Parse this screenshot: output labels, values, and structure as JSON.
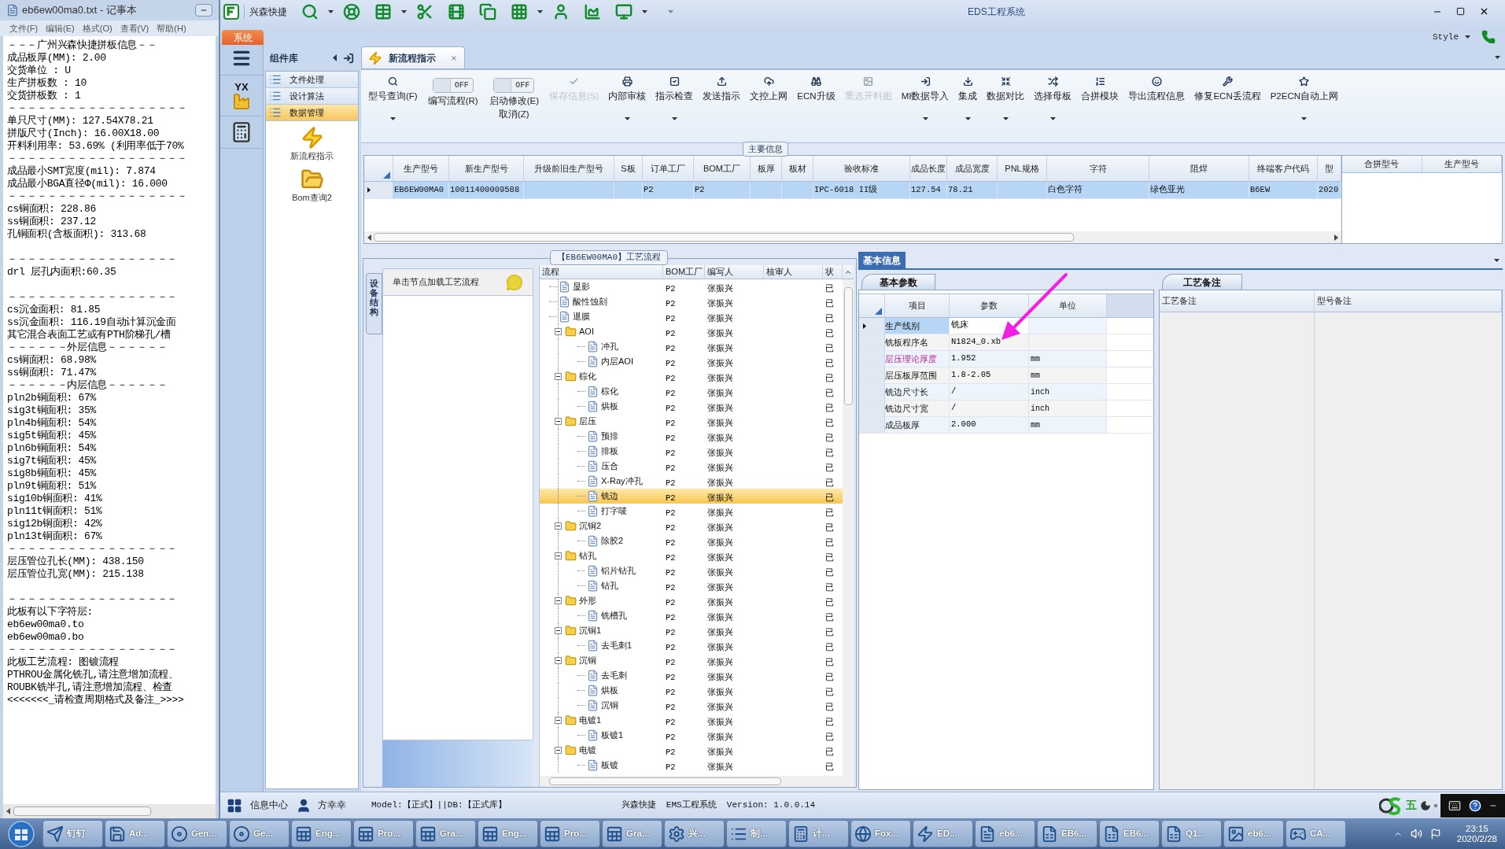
{
  "notepad": {
    "title": "eb6ew00ma0.txt - 记事本",
    "menu": [
      "文件(F)",
      "编辑(E)",
      "格式(O)",
      "查看(V)",
      "帮助(H)"
    ],
    "lines": [
      {
        "kind": "text",
        "text": "－－－广州兴森快捷拼板信息－－"
      },
      {
        "kind": "text",
        "text": "成品板厚(MM): 2.00"
      },
      {
        "kind": "text",
        "text": "交货单位 : U"
      },
      {
        "kind": "text",
        "text": "生产拼板数 : 10"
      },
      {
        "kind": "text",
        "text": "交货拼板数 : 1"
      },
      {
        "kind": "text",
        "text": "－－－－－－－－－－－－－－－－－－"
      },
      {
        "kind": "text",
        "text": "单只尺寸(MM): 127.54X78.21"
      },
      {
        "kind": "text",
        "text": "拼版尺寸(Inch): 16.00X18.00"
      },
      {
        "kind": "text",
        "text": "开料利用率: 53.69% (利用率低于70%"
      },
      {
        "kind": "text",
        "text": "－－－－－－－－－－－－－－－－－－"
      },
      {
        "kind": "text",
        "text": "成品最小SMT宽度(mil): 7.874"
      },
      {
        "kind": "text",
        "text": "成品最小BGA直径Φ(mil):  16.000"
      },
      {
        "kind": "text",
        "text": "－－－－－－－－－－－－－－－－－－"
      },
      {
        "kind": "text",
        "text": "cs铜面积: 228.86"
      },
      {
        "kind": "text",
        "text": "ss铜面积: 237.12"
      },
      {
        "kind": "text",
        "text": "孔铜面积(含板面积): 313.68"
      },
      {
        "kind": "gap"
      },
      {
        "kind": "text",
        "text": "－－－－－－－－－－－－－－－－－"
      },
      {
        "kind": "text",
        "text": "drl          层孔内面积:60.35"
      },
      {
        "kind": "gap"
      },
      {
        "kind": "text",
        "text": "－－－－－－－－－－－－－－－－－"
      },
      {
        "kind": "text",
        "text": "cs沉金面积: 81.85"
      },
      {
        "kind": "text",
        "text": "ss沉金面积: 116.19自动计算沉金面"
      },
      {
        "kind": "text",
        "text": "其它混合表面工艺或有PTH阶梯孔/槽"
      },
      {
        "kind": "text",
        "text": "－－－－－－外层信息－－－－－－"
      },
      {
        "kind": "text",
        "text": "cs铜面积: 68.98%"
      },
      {
        "kind": "text",
        "text": "ss铜面积: 71.47%"
      },
      {
        "kind": "text",
        "text": "－－－－－－内层信息－－－－－－"
      },
      {
        "kind": "text",
        "text": "pln2b铜面积: 67%"
      },
      {
        "kind": "text",
        "text": "sig3t铜面积: 35%"
      },
      {
        "kind": "text",
        "text": "pln4b铜面积: 54%"
      },
      {
        "kind": "text",
        "text": "sig5t铜面积: 45%"
      },
      {
        "kind": "text",
        "text": "pln6b铜面积: 54%"
      },
      {
        "kind": "text",
        "text": "sig7t铜面积: 45%"
      },
      {
        "kind": "text",
        "text": "sig8b铜面积: 45%"
      },
      {
        "kind": "text",
        "text": "pln9t铜面积: 51%"
      },
      {
        "kind": "text",
        "text": "sig10b铜面积: 41%"
      },
      {
        "kind": "text",
        "text": "pln11t铜面积: 51%"
      },
      {
        "kind": "text",
        "text": "sig12b铜面积: 42%"
      },
      {
        "kind": "text",
        "text": "pln13t铜面积: 67%"
      },
      {
        "kind": "text",
        "text": "－－－－－－－－－－－－－－－－－"
      },
      {
        "kind": "text",
        "text": "层压管位孔长(MM): 438.150"
      },
      {
        "kind": "text",
        "text": "层压管位孔宽(MM): 215.138"
      },
      {
        "kind": "gap"
      },
      {
        "kind": "text",
        "text": "－－－－－－－－－－－－－－－－－"
      },
      {
        "kind": "text",
        "text": "此板有以下字符层:"
      },
      {
        "kind": "text",
        "text": "eb6ew00ma0.to"
      },
      {
        "kind": "text",
        "text": "eb6ew00ma0.bo"
      },
      {
        "kind": "text",
        "text": "－－－－－－－－－－－－－－－－－"
      },
      {
        "kind": "text",
        "text": "此板工艺流程: 图镀流程"
      },
      {
        "kind": "text",
        "text": "PTHROU金属化铣孔,请注意增加流程、"
      },
      {
        "kind": "text",
        "text": "ROUBK铣半孔,请注意增加流程、检查"
      },
      {
        "kind": "text",
        "text": "<<<<<<<_请检查周期格式及备注_>>>>"
      }
    ]
  },
  "app": {
    "brand": "兴森快捷",
    "title": "EDS工程系统",
    "style_menu": "Style",
    "system_tab": "系统",
    "side_logo": "YX"
  },
  "components": {
    "title": "组件库",
    "items": [
      {
        "label": "文件处理",
        "selected": false
      },
      {
        "label": "设计算法",
        "selected": false
      },
      {
        "label": "数据管理",
        "selected": true
      }
    ],
    "shortcuts": [
      {
        "label": "新流程指示"
      },
      {
        "label": "Bom查询2"
      }
    ]
  },
  "doc_tab": {
    "label": "新流程指示"
  },
  "ribbon": [
    {
      "kind": "button",
      "label": "型号查询(F)",
      "disabled": false,
      "dropdown": true
    },
    {
      "kind": "toggle",
      "label": "编写流程(R)",
      "state": "OFF",
      "on": false
    },
    {
      "kind": "toggle",
      "label": "启动修改(E)",
      "sublabel": "取消(Z)",
      "state": "OFF",
      "on": false
    },
    {
      "kind": "button",
      "label": "保存信息(S)",
      "disabled": true,
      "dropdown": false
    },
    {
      "kind": "button",
      "label": "内部审核",
      "disabled": false,
      "dropdown": true
    },
    {
      "kind": "button",
      "label": "指示检查",
      "disabled": false,
      "dropdown": true
    },
    {
      "kind": "button",
      "label": "发送指示",
      "disabled": false,
      "dropdown": false
    },
    {
      "kind": "button",
      "label": "文控上网",
      "disabled": false,
      "dropdown": false
    },
    {
      "kind": "button",
      "label": "ECN升级",
      "disabled": false,
      "dropdown": false
    },
    {
      "kind": "button",
      "label": "重选开料图",
      "disabled": true,
      "dropdown": false
    },
    {
      "kind": "button",
      "label": "MI数据导入",
      "disabled": false,
      "dropdown": true
    },
    {
      "kind": "button",
      "label": "集成",
      "disabled": false,
      "dropdown": true
    },
    {
      "kind": "button",
      "label": "数据对比",
      "disabled": false,
      "dropdown": true
    },
    {
      "kind": "button",
      "label": "选择母板",
      "disabled": false,
      "dropdown": true
    },
    {
      "kind": "button",
      "label": "合拼模块",
      "disabled": false,
      "dropdown": false
    },
    {
      "kind": "button",
      "label": "导出流程信息",
      "disabled": false,
      "dropdown": false
    },
    {
      "kind": "button",
      "label": "修复ECN丢流程",
      "disabled": false,
      "dropdown": false
    },
    {
      "kind": "button",
      "label": "P2ECN自动上网",
      "disabled": false,
      "dropdown": true
    }
  ],
  "main_info": {
    "title": "主要信息",
    "columns": [
      "生产型号",
      "新生产型号",
      "升级前旧生产型号",
      "S板",
      "订单工厂",
      "BOM工厂",
      "板厚",
      "板材",
      "验收标准",
      "成品长度",
      "成品宽度",
      "PNL规格",
      "字符",
      "阻焊",
      "终端客户代码",
      "型"
    ],
    "rows": [
      {
        "selected": true,
        "cells": [
          "EB6EW00MA0",
          "10011400009588",
          null,
          null,
          "P2",
          "P2",
          null,
          null,
          "IPC-6018 II级",
          "127.54",
          "78.21",
          null,
          "白色字符",
          "绿色亚光",
          "B6EW",
          "2020"
        ]
      }
    ],
    "side_columns": [
      "合拼型号",
      "生产型号"
    ]
  },
  "flow": {
    "title": "【EB6EW00MA0】工艺流程",
    "side_tab": "设备结构",
    "hint": "单击节点加载工艺流程",
    "columns": [
      "流程",
      "BOM工厂",
      "编写人",
      "核审人",
      "状"
    ],
    "tree": [
      {
        "kind": "group",
        "children": [
          {
            "kind": "step",
            "name": "显影",
            "factory": "P2",
            "writer": "张振兴",
            "status": "已",
            "selected": false
          },
          {
            "kind": "step",
            "name": "酸性蚀刻",
            "factory": "P2",
            "writer": "张振兴",
            "status": "已",
            "selected": false
          },
          {
            "kind": "step",
            "name": "退膜",
            "factory": "P2",
            "writer": "张振兴",
            "status": "已",
            "selected": false
          }
        ]
      },
      {
        "kind": "group",
        "name": "AOI",
        "factory": "P2",
        "writer": "张振兴",
        "status": "已",
        "selected": false,
        "expanded": true,
        "children": [
          {
            "kind": "step",
            "name": "冲孔",
            "factory": "P2",
            "writer": "张振兴",
            "status": "已",
            "selected": false
          },
          {
            "kind": "step",
            "name": "内层AOI",
            "factory": "P2",
            "writer": "张振兴",
            "status": "已",
            "selected": false
          }
        ]
      },
      {
        "kind": "group",
        "name": "棕化",
        "factory": "P2",
        "writer": "张振兴",
        "status": "已",
        "selected": false,
        "expanded": true,
        "children": [
          {
            "kind": "step",
            "name": "棕化",
            "factory": "P2",
            "writer": "张振兴",
            "status": "已",
            "selected": false
          },
          {
            "kind": "step",
            "name": "烘板",
            "factory": "P2",
            "writer": "张振兴",
            "status": "已",
            "selected": false
          }
        ]
      },
      {
        "kind": "group",
        "name": "层压",
        "factory": "P2",
        "writer": "张振兴",
        "status": "已",
        "selected": false,
        "expanded": true,
        "children": [
          {
            "kind": "step",
            "name": "预排",
            "factory": "P2",
            "writer": "张振兴",
            "status": "已",
            "selected": false
          },
          {
            "kind": "step",
            "name": "排板",
            "factory": "P2",
            "writer": "张振兴",
            "status": "已",
            "selected": false
          },
          {
            "kind": "step",
            "name": "压合",
            "factory": "P2",
            "writer": "张振兴",
            "status": "已",
            "selected": false
          },
          {
            "kind": "step",
            "name": "X-Ray冲孔",
            "factory": "P2",
            "writer": "张振兴",
            "status": "已",
            "selected": false
          },
          {
            "kind": "step",
            "name": "铣边",
            "factory": "P2",
            "writer": "张振兴",
            "status": "已",
            "selected": true
          },
          {
            "kind": "step",
            "name": "打字唛",
            "factory": "P2",
            "writer": "张振兴",
            "status": "已",
            "selected": false
          }
        ]
      },
      {
        "kind": "group",
        "name": "沉铜2",
        "factory": "P2",
        "writer": "张振兴",
        "status": "已",
        "selected": false,
        "expanded": true,
        "children": [
          {
            "kind": "step",
            "name": "除胶2",
            "factory": "P2",
            "writer": "张振兴",
            "status": "已",
            "selected": false
          }
        ]
      },
      {
        "kind": "group",
        "name": "钻孔",
        "factory": "P2",
        "writer": "张振兴",
        "status": "已",
        "selected": false,
        "expanded": true,
        "children": [
          {
            "kind": "step",
            "name": "铝片钻孔",
            "factory": "P2",
            "writer": "张振兴",
            "status": "已",
            "selected": false
          },
          {
            "kind": "step",
            "name": "钻孔",
            "factory": "P2",
            "writer": "张振兴",
            "status": "已",
            "selected": false
          }
        ]
      },
      {
        "kind": "group",
        "name": "外形",
        "factory": "P2",
        "writer": "张振兴",
        "status": "已",
        "selected": false,
        "expanded": true,
        "children": [
          {
            "kind": "step",
            "name": "铣槽孔",
            "factory": "P2",
            "writer": "张振兴",
            "status": "已",
            "selected": false
          }
        ]
      },
      {
        "kind": "group",
        "name": "沉铜1",
        "factory": "P2",
        "writer": "张振兴",
        "status": "已",
        "selected": false,
        "expanded": true,
        "children": [
          {
            "kind": "step",
            "name": "去毛刺1",
            "factory": "P2",
            "writer": "张振兴",
            "status": "已",
            "selected": false
          }
        ]
      },
      {
        "kind": "group",
        "name": "沉铜",
        "factory": "P2",
        "writer": "张振兴",
        "status": "已",
        "selected": false,
        "expanded": true,
        "children": [
          {
            "kind": "step",
            "name": "去毛刺",
            "factory": "P2",
            "writer": "张振兴",
            "status": "已",
            "selected": false
          },
          {
            "kind": "step",
            "name": "烘板",
            "factory": "P2",
            "writer": "张振兴",
            "status": "已",
            "selected": false
          },
          {
            "kind": "step",
            "name": "沉铜",
            "factory": "P2",
            "writer": "张振兴",
            "status": "已",
            "selected": false
          }
        ]
      },
      {
        "kind": "group",
        "name": "电镀1",
        "factory": "P2",
        "writer": "张振兴",
        "status": "已",
        "selected": false,
        "expanded": true,
        "children": [
          {
            "kind": "step",
            "name": "板镀1",
            "factory": "P2",
            "writer": "张振兴",
            "status": "已",
            "selected": false
          }
        ]
      },
      {
        "kind": "group",
        "name": "电镀",
        "factory": "P2",
        "writer": "张振兴",
        "status": "已",
        "selected": false,
        "expanded": true,
        "children": [
          {
            "kind": "step",
            "name": "板镀",
            "factory": "P2",
            "writer": "张振兴",
            "status": "已",
            "selected": false
          }
        ]
      }
    ]
  },
  "basic_info": {
    "title": "基本信息",
    "params_tab": "基本参数",
    "columns": [
      "项目",
      "参数",
      "单位"
    ],
    "rows": [
      {
        "item": "生产线别",
        "value": "铣床",
        "unit": null,
        "selected": true,
        "highlighted": false
      },
      {
        "item": "铣板程序名",
        "value": "N1824_0.xb",
        "unit": null,
        "selected": false,
        "highlighted": false
      },
      {
        "item": "层压理论厚度",
        "value": "1.952",
        "unit": "mm",
        "selected": false,
        "highlighted": true
      },
      {
        "item": "层压板厚范围",
        "value": "1.8-2.05",
        "unit": "mm",
        "selected": false,
        "highlighted": false
      },
      {
        "item": "铣边尺寸长",
        "value": "/",
        "unit": "inch",
        "selected": false,
        "highlighted": false
      },
      {
        "item": "铣边尺寸宽",
        "value": "/",
        "unit": "inch",
        "selected": false,
        "highlighted": false
      },
      {
        "item": "成品板厚",
        "value": "2.000",
        "unit": "mm",
        "selected": false,
        "highlighted": false
      }
    ],
    "notes_tab": "工艺备注",
    "notes_columns": [
      "工艺备注",
      "型号备注"
    ]
  },
  "status_bar": {
    "info_center": "信息中心",
    "user": "方幸幸",
    "model": "Model:【正式】||DB:【正式库】",
    "version": "兴森快捷  EMS工程系统  Version: 1.0.0.14",
    "ime": "五"
  },
  "taskbar": {
    "items": [
      {
        "label": "钉钉"
      },
      {
        "label": "Ad..."
      },
      {
        "label": "Gen..."
      },
      {
        "label": "Ge..."
      },
      {
        "label": "Eng..."
      },
      {
        "label": "Pro..."
      },
      {
        "label": "Gra..."
      },
      {
        "label": "Eng..."
      },
      {
        "label": "Pro..."
      },
      {
        "label": "Gra..."
      },
      {
        "label": "兴..."
      },
      {
        "label": "制..."
      },
      {
        "label": "计..."
      },
      {
        "label": "Fox..."
      },
      {
        "label": "ED..."
      },
      {
        "label": "eb6..."
      },
      {
        "label": "EB6..."
      },
      {
        "label": "EB6..."
      },
      {
        "label": "Q1..."
      },
      {
        "label": "eb6..."
      },
      {
        "label": "CA..."
      }
    ],
    "time": "23:15",
    "date": "2020/2/28"
  }
}
